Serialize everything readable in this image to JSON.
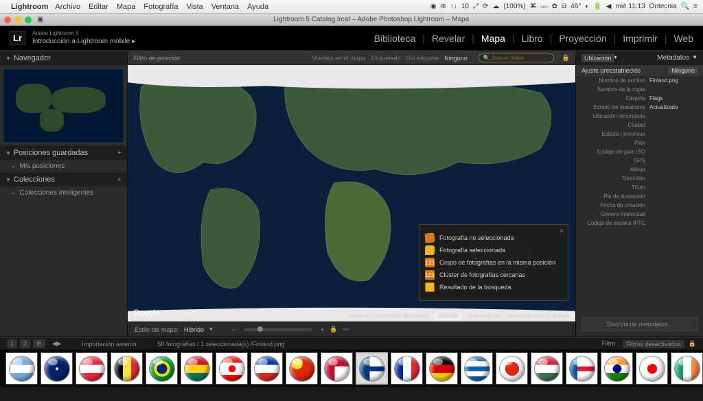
{
  "mac_menu": {
    "app": "Lightroom",
    "items": [
      "Archivo",
      "Editar",
      "Mapa",
      "Fotografía",
      "Vista",
      "Ventana",
      "Ayuda"
    ],
    "tray_count": "10",
    "tray_pct": "(100%)",
    "tray_temp": "46°",
    "clock": "mié 11:13",
    "user": "Ontecnia"
  },
  "window": {
    "title": "Lightroom 5 Catalog.lrcat – Adobe Photoshop Lightroom – Mapa"
  },
  "header": {
    "brand": "Adobe Lightroom 5",
    "intro": "Introducción a Lightroom mobile  ▸",
    "modules": [
      "Biblioteca",
      "Revelar",
      "Mapa",
      "Libro",
      "Proyección",
      "Imprimir",
      "Web"
    ],
    "active_module": "Mapa"
  },
  "left": {
    "navigator": "Navegador",
    "saved": "Posiciones guardadas",
    "my_pos": "Mis posiciones",
    "collections": "Colecciones",
    "smart": "Colecciones inteligentes"
  },
  "filter": {
    "label": "Filtro de posición:",
    "opts": [
      "Visibles en el mapa",
      "Etiquetado",
      "Sin etiqueta",
      "Ninguno"
    ],
    "active": "Ninguno",
    "search_placeholder": "Buscar mapa"
  },
  "legend": {
    "r1": "Fotografía no seleccionada",
    "r2": "Fotografía seleccionada",
    "r3": "Grupo de fotografías en la misma posición",
    "r3n": "123",
    "r4": "Clúster de fotografías cercanas",
    "r4n": "123",
    "r5": "Resultado de la búsqueda"
  },
  "map": {
    "google": "Google",
    "credits": "Imágenes ©2014 NASA, TerraMetrics",
    "scale": "1000 km",
    "terms": "Términos de uso",
    "report": "Informar de un error de Maps"
  },
  "style_bar": {
    "label": "Estilo del mapa:",
    "value": "Híbrido"
  },
  "right": {
    "loc_dd": "Ubicación",
    "title": "Metadatos",
    "preset_k": "Ajuste preestablecido",
    "preset_v": "Ninguno",
    "rows": [
      {
        "k": "Nombre de archivo",
        "v": "Finland.png"
      },
      {
        "k": "Nombre de la copia",
        "v": ""
      },
      {
        "k": "Carpeta",
        "v": "Flags"
      },
      {
        "k": "Estado de metadatos",
        "v": "Actualizado"
      },
      {
        "k": "Ubicación secundaria",
        "v": ""
      },
      {
        "k": "Ciudad",
        "v": ""
      },
      {
        "k": "Estado / provincia",
        "v": ""
      },
      {
        "k": "País",
        "v": ""
      },
      {
        "k": "Código de país ISO",
        "v": ""
      },
      {
        "k": "GPS",
        "v": ""
      },
      {
        "k": "Altitud",
        "v": ""
      },
      {
        "k": "Dirección",
        "v": ""
      },
      {
        "k": "Título",
        "v": ""
      },
      {
        "k": "Pie de ilustración",
        "v": ""
      },
      {
        "k": "Fecha de creación",
        "v": ""
      },
      {
        "k": "Género intelectual",
        "v": ""
      },
      {
        "k": "Código de escena IPTC",
        "v": ""
      }
    ],
    "sync": "Sincronizar metadatos..."
  },
  "filmstrip": {
    "nav1": "1",
    "nav2": "2",
    "grid": "⊞",
    "label": "Importación anterior",
    "count": "50 fotografías / 1 seleccionada(s) /Finland.png",
    "filter_label": "Filtro :",
    "filter_value": "Filtros desactivados",
    "flags": [
      {
        "bg": "linear-gradient(180deg,#75aadb 33%,#fff 33%,#fff 66%,#75aadb 66%)"
      },
      {
        "bg": "radial-gradient(circle at 50% 50%, #fff 2px, transparent 2px), #012169"
      },
      {
        "bg": "linear-gradient(180deg,#ed2939 33%,#fff 33%,#fff 66%,#ed2939 66%)"
      },
      {
        "bg": "linear-gradient(90deg,#000 33%,#fae042 33%,#fae042 66%,#ed2939 66%)"
      },
      {
        "bg": "radial-gradient(circle,#002776 30%,#ffdf00 30%,#ffdf00 45%,#009b3a 45%)"
      },
      {
        "bg": "linear-gradient(180deg,#ce1126 33%,#fcd116 33%,#fcd116 66%,#007a5e 66%)"
      },
      {
        "bg": "radial-gradient(circle,#ff0000 20%,transparent 20%),linear-gradient(180deg,#ff0000 25%,#fff 25%,#fff 75%,#ff0000 75%)"
      },
      {
        "bg": "linear-gradient(180deg,#0039a6 33%,#fff 33%,#fff 66%,#d52b1e 66%)"
      },
      {
        "bg": "radial-gradient(circle at 30% 30%,#ffde00 8px,#de2910 8px)"
      },
      {
        "bg": "linear-gradient(90deg,#c60c30 40%,transparent 40%),linear-gradient(180deg,#c60c30 40%,transparent 40%),#fff"
      },
      {
        "bg": "linear-gradient(90deg,#003580 40%,transparent 40%),linear-gradient(180deg,transparent 40%,#003580 40%,#003580 60%,transparent 60%),#fff"
      },
      {
        "bg": "linear-gradient(90deg,#002395 33%,#fff 33%,#fff 66%,#ed2939 66%)"
      },
      {
        "bg": "linear-gradient(180deg,#000 33%,#dd0000 33%,#dd0000 66%,#ffce00 66%)"
      },
      {
        "bg": "linear-gradient(180deg,#0d5eaf 20%,#fff 20%,#fff 40%,#0d5eaf 40%,#0d5eaf 60%,#fff 60%,#fff 80%,#0d5eaf 80%)"
      },
      {
        "bg": "radial-gradient(circle,#de2910 40%,#fff 40%)"
      },
      {
        "bg": "linear-gradient(180deg,#cd2a3e 33%,#fff 33%,#fff 66%,#436f4d 66%)"
      },
      {
        "bg": "linear-gradient(90deg,#02529c 30%,transparent 30%),linear-gradient(180deg,transparent 40%,#dc1e35 40%,#dc1e35 60%,transparent 60%),#fff"
      },
      {
        "bg": "radial-gradient(circle,#000080 25%,transparent 25%),linear-gradient(180deg,#ff9933 33%,#fff 33%,#fff 66%,#138808 66%)"
      },
      {
        "bg": "radial-gradient(circle,#ff0000 28%,#fff 28%)"
      },
      {
        "bg": "linear-gradient(90deg,#169b62 33%,#fff 33%,#fff 66%,#ff883e 66%)"
      },
      {
        "bg": "radial-gradient(circle,#0038b8 20%,transparent 20%),#fff"
      },
      {
        "bg": "linear-gradient(90deg,#009246 33%,#fff 33%,#fff 66%,#ce2b37 66%)"
      }
    ],
    "selected": 10
  }
}
